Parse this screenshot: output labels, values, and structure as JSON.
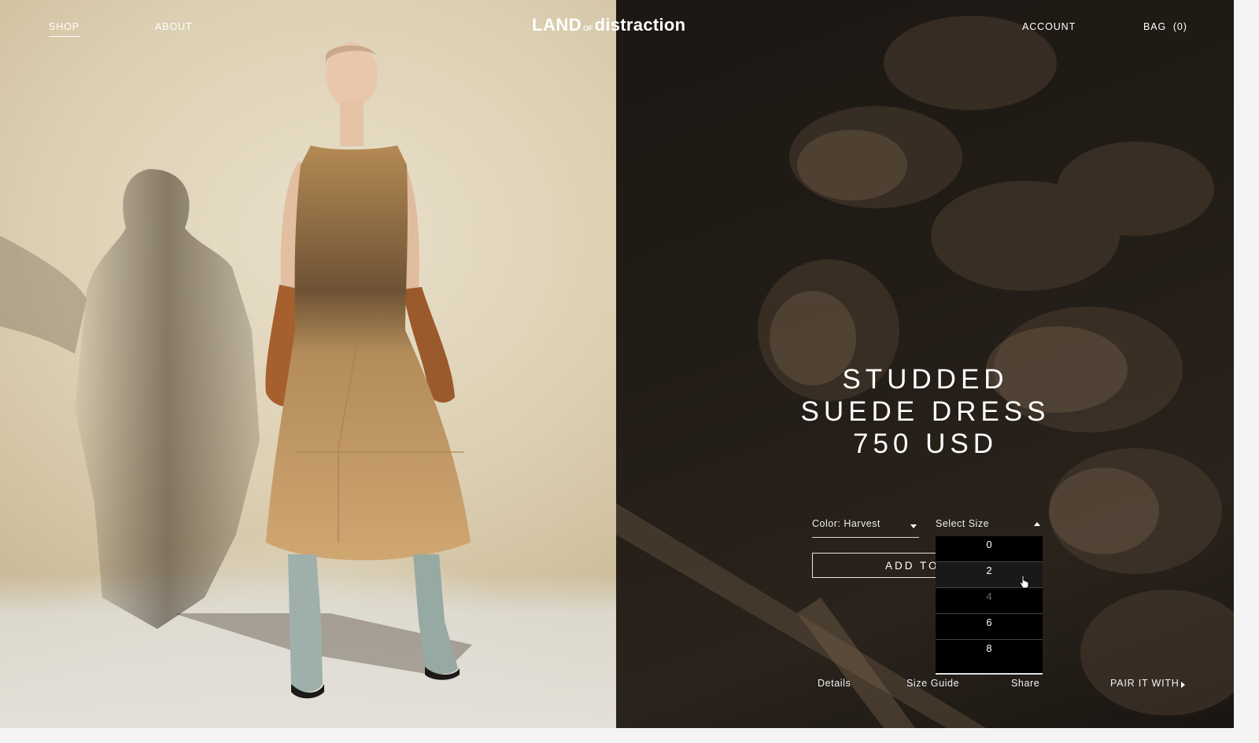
{
  "header": {
    "nav_left": [
      "SHOP",
      "ABOUT"
    ],
    "logo": {
      "part1": "LAND",
      "part2": "OF",
      "part3": "distraction"
    },
    "account": "ACCOUNT",
    "bag": "BAG  (0)"
  },
  "product": {
    "title_line1": "STUDDED",
    "title_line2": "SUEDE DRESS",
    "price": "750 USD",
    "color_select": "Color: Harvest",
    "size_select": "Select Size",
    "add_button": "ADD TO",
    "size_options": [
      {
        "label": "0",
        "state": "available"
      },
      {
        "label": "2",
        "state": "hover"
      },
      {
        "label": "4",
        "state": "disabled"
      },
      {
        "label": "6",
        "state": "available"
      },
      {
        "label": "8",
        "state": "available"
      }
    ]
  },
  "footer_links": {
    "details": "Details",
    "size_guide": "Size Guide",
    "share": "Share",
    "pair": "PAIR IT WITH"
  },
  "colors": {
    "right_panel_bg": "#211b15",
    "dropdown_bg": "#000000",
    "dress": "#c49a62",
    "gloves": "#a5602e",
    "boots": "#9fb0aa"
  }
}
